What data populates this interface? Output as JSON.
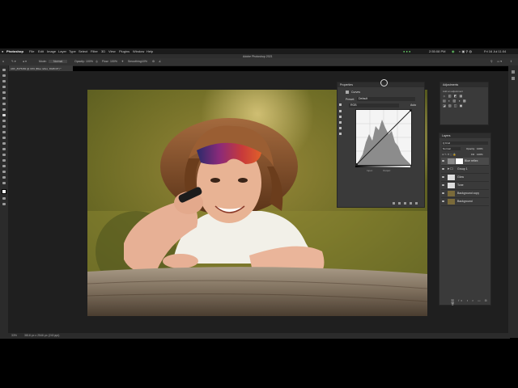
{
  "menubar": {
    "app_name": "Photoshop",
    "menus": [
      "File",
      "Edit",
      "Image",
      "Layer",
      "Type",
      "Select",
      "Filter",
      "3D",
      "View",
      "Plugins",
      "Window",
      "Help"
    ],
    "clock": "Fri 16 Jul 11:04",
    "battery": "2:55:08 PM"
  },
  "window_title": "Adobe Photoshop 2021",
  "options_bar": {
    "mode_label": "Mode:",
    "mode_value": "Normal",
    "opacity_label": "Opacity:",
    "opacity_value": "100%",
    "flow_label": "Flow:",
    "flow_value": "100%",
    "smoothing_label": "Smoothing:",
    "smoothing_value": "10%"
  },
  "document_tab": "ADF_8375282 @ 33% (Blue reflex, RGB/16*) *",
  "status": {
    "zoom": "33%",
    "doc_info": "3818 px x 2546 px (240 ppi)"
  },
  "properties_panel": {
    "title": "Properties",
    "subtitle": "Curves",
    "preset_label": "Preset:",
    "preset_value": "Default",
    "channel_value": "RGB",
    "auto_label": "Auto",
    "input_label": "Input:",
    "output_label": "Output:"
  },
  "adjustments_panel": {
    "title": "Adjustments",
    "subtitle": "Add an adjustment"
  },
  "layers_panel": {
    "title": "Layers",
    "kind_label": "Q Kind",
    "blend_mode": "Normal",
    "opacity_label": "Opacity:",
    "opacity_value": "100%",
    "fill_label": "Fill:",
    "fill_value": "100%",
    "layers": [
      {
        "name": "Blue reflex"
      },
      {
        "name": "Group 1"
      },
      {
        "name": "Glow"
      },
      {
        "name": "Tone"
      },
      {
        "name": "Background copy"
      },
      {
        "name": "Background"
      }
    ]
  }
}
